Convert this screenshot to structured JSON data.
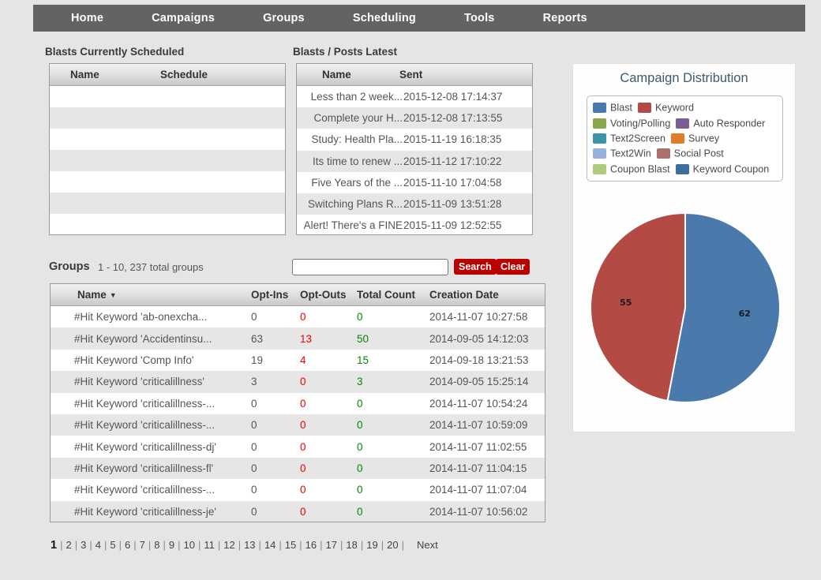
{
  "nav": {
    "items": [
      {
        "label": "Home"
      },
      {
        "label": "Campaigns"
      },
      {
        "label": "Groups"
      },
      {
        "label": "Scheduling"
      },
      {
        "label": "Tools"
      },
      {
        "label": "Reports"
      }
    ]
  },
  "scheduled": {
    "title": "Blasts Currently Scheduled",
    "columns": [
      "Name",
      "Schedule"
    ],
    "rows": [
      {
        "name": "",
        "schedule": ""
      },
      {
        "name": "",
        "schedule": ""
      },
      {
        "name": "",
        "schedule": ""
      },
      {
        "name": "",
        "schedule": ""
      },
      {
        "name": "",
        "schedule": ""
      },
      {
        "name": "",
        "schedule": ""
      },
      {
        "name": "",
        "schedule": ""
      }
    ]
  },
  "latest": {
    "title": "Blasts / Posts Latest",
    "columns": [
      "Name",
      "Sent"
    ],
    "rows": [
      {
        "name": "Less than 2 week...",
        "sent": "2015-12-08 17:14:37"
      },
      {
        "name": "Complete your H...",
        "sent": "2015-12-08 17:13:55"
      },
      {
        "name": "Study: Health Pla...",
        "sent": "2015-11-19 16:18:35"
      },
      {
        "name": "Its time to renew ...",
        "sent": "2015-11-12 17:10:22"
      },
      {
        "name": "Five Years of the ...",
        "sent": "2015-11-10 17:04:58"
      },
      {
        "name": "Switching Plans R...",
        "sent": "2015-11-09 13:51:28"
      },
      {
        "name": "Alert! There's a FINE",
        "sent": "2015-11-09 12:52:55"
      }
    ]
  },
  "groups": {
    "label": "Groups",
    "count_text": "1 - 10, 237 total groups",
    "search_value": "",
    "search_placeholder": "",
    "search_button": "Search",
    "clear_button": "Clear",
    "columns": {
      "name": "Name",
      "opt_ins": "Opt-Ins",
      "opt_outs": "Opt-Outs",
      "total_count": "Total Count",
      "creation_date": "Creation Date"
    },
    "sort_arrow": "▼",
    "rows": [
      {
        "name": "#Hit Keyword 'ab-onexcha...",
        "opt_ins": "0",
        "opt_outs": "0",
        "total_count": "0",
        "creation_date": "2014-11-07 10:27:58"
      },
      {
        "name": "#Hit Keyword 'Accidentinsu...",
        "opt_ins": "63",
        "opt_outs": "13",
        "total_count": "50",
        "creation_date": "2014-09-05 14:12:03"
      },
      {
        "name": "#Hit Keyword 'Comp Info'",
        "opt_ins": "19",
        "opt_outs": "4",
        "total_count": "15",
        "creation_date": "2014-09-18 13:21:53"
      },
      {
        "name": "#Hit Keyword 'criticalillness'",
        "opt_ins": "3",
        "opt_outs": "0",
        "total_count": "3",
        "creation_date": "2014-09-05 15:25:14"
      },
      {
        "name": "#Hit Keyword 'criticalillness-...",
        "opt_ins": "0",
        "opt_outs": "0",
        "total_count": "0",
        "creation_date": "2014-11-07 10:54:24"
      },
      {
        "name": "#Hit Keyword 'criticalillness-...",
        "opt_ins": "0",
        "opt_outs": "0",
        "total_count": "0",
        "creation_date": "2014-11-07 10:59:09"
      },
      {
        "name": "#Hit Keyword 'criticalillness-dj'",
        "opt_ins": "0",
        "opt_outs": "0",
        "total_count": "0",
        "creation_date": "2014-11-07 11:02:55"
      },
      {
        "name": "#Hit Keyword 'criticalillness-fl'",
        "opt_ins": "0",
        "opt_outs": "0",
        "total_count": "0",
        "creation_date": "2014-11-07 11:04:15"
      },
      {
        "name": "#Hit Keyword 'criticalillness-...",
        "opt_ins": "0",
        "opt_outs": "0",
        "total_count": "0",
        "creation_date": "2014-11-07 11:07:04"
      },
      {
        "name": "#Hit Keyword 'criticalillness-je'",
        "opt_ins": "0",
        "opt_outs": "0",
        "total_count": "0",
        "creation_date": "2014-11-07 10:56:02"
      }
    ]
  },
  "pagination": {
    "pages": [
      "1",
      "2",
      "3",
      "4",
      "5",
      "6",
      "7",
      "8",
      "9",
      "10",
      "11",
      "12",
      "13",
      "14",
      "15",
      "16",
      "17",
      "18",
      "19",
      "20"
    ],
    "active": "1",
    "separator": "|",
    "next_label": "Next"
  },
  "chart_data": {
    "type": "pie",
    "title": "Campaign Distribution",
    "legend_position": "top",
    "labels": [
      "Blast",
      "Keyword",
      "Voting/Polling",
      "Auto Responder",
      "Text2Screen",
      "Survey",
      "Text2Win",
      "Social Post",
      "Coupon Blast",
      "Keyword Coupon"
    ],
    "colors": [
      "#4a7aab",
      "#b34a44",
      "#89a64a",
      "#7b5e96",
      "#3f93a8",
      "#e07b28",
      "#96b1da",
      "#ab6f6c",
      "#b0cb7c",
      "#3d6f9e"
    ],
    "values": [
      62,
      55,
      0,
      0,
      0,
      0,
      0,
      0,
      0,
      0
    ],
    "visible_slices": [
      {
        "label": "Blast",
        "value": 62,
        "color": "#4a7aab"
      },
      {
        "label": "Keyword",
        "value": 55,
        "color": "#b34a44"
      }
    ],
    "data_labels": [
      "62",
      "55"
    ]
  }
}
